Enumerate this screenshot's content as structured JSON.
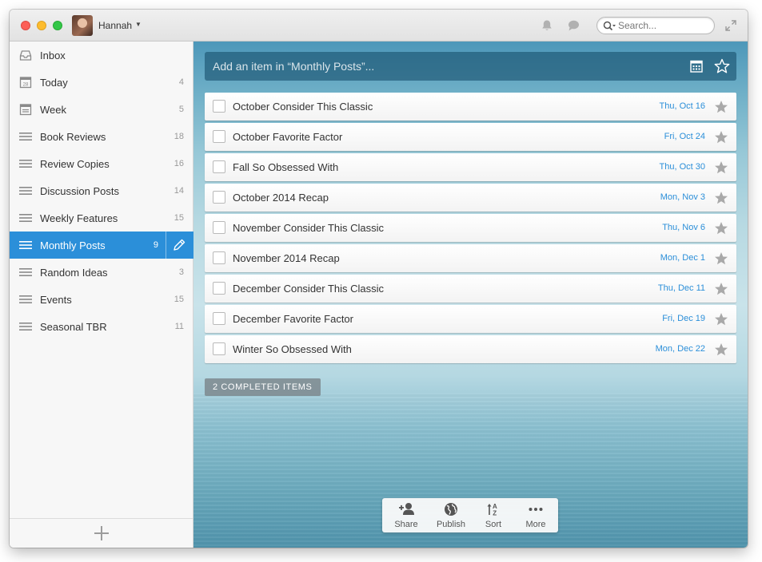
{
  "titlebar": {
    "user_name": "Hannah",
    "search_placeholder": "Search..."
  },
  "sidebar": {
    "items": [
      {
        "label": "Inbox",
        "count": "",
        "icon": "inbox-icon"
      },
      {
        "label": "Today",
        "count": "4",
        "icon": "calendar-today-icon"
      },
      {
        "label": "Week",
        "count": "5",
        "icon": "calendar-week-icon"
      },
      {
        "label": "Book Reviews",
        "count": "18",
        "icon": "list-icon"
      },
      {
        "label": "Review Copies",
        "count": "16",
        "icon": "list-icon"
      },
      {
        "label": "Discussion Posts",
        "count": "14",
        "icon": "list-icon"
      },
      {
        "label": "Weekly Features",
        "count": "15",
        "icon": "list-icon"
      },
      {
        "label": "Monthly Posts",
        "count": "9",
        "icon": "list-icon",
        "active": true
      },
      {
        "label": "Random Ideas",
        "count": "3",
        "icon": "list-icon"
      },
      {
        "label": "Events",
        "count": "15",
        "icon": "list-icon"
      },
      {
        "label": "Seasonal TBR",
        "count": "11",
        "icon": "list-icon"
      }
    ],
    "add_list_icon": "plus-icon"
  },
  "main": {
    "add_placeholder": "Add an item in “Monthly Posts”...",
    "tasks": [
      {
        "title": "October Consider This Classic",
        "date": "Thu, Oct 16"
      },
      {
        "title": "October Favorite Factor",
        "date": "Fri, Oct 24"
      },
      {
        "title": "Fall So Obsessed With",
        "date": "Thu, Oct 30"
      },
      {
        "title": "October 2014 Recap",
        "date": "Mon, Nov 3"
      },
      {
        "title": "November Consider This Classic",
        "date": "Thu, Nov 6"
      },
      {
        "title": "November 2014 Recap",
        "date": "Mon, Dec 1"
      },
      {
        "title": "December Consider This Classic",
        "date": "Thu, Dec 11"
      },
      {
        "title": "December Favorite Factor",
        "date": "Fri, Dec 19"
      },
      {
        "title": "Winter So Obsessed With",
        "date": "Mon, Dec 22"
      }
    ],
    "completed_label": "2 COMPLETED ITEMS",
    "toolbar": {
      "share": "Share",
      "publish": "Publish",
      "sort": "Sort",
      "more": "More"
    }
  },
  "colors": {
    "accent": "#2b8fd9",
    "date_text": "#2b8fd9",
    "star": "#a9a9a9"
  }
}
